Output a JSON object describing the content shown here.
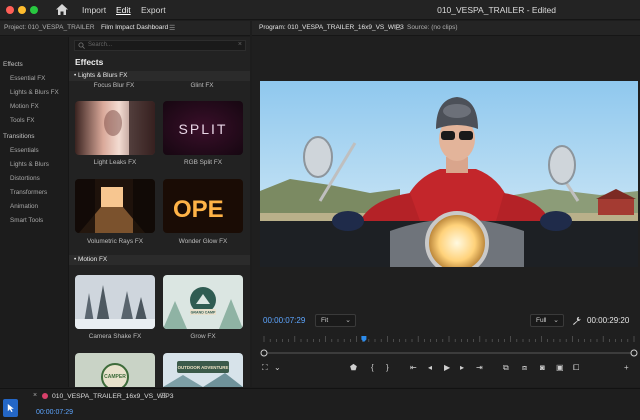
{
  "titlebar": {
    "menus": [
      "Import",
      "Edit",
      "Export"
    ],
    "active_menu": "Edit",
    "title": "010_VESPA_TRAILER - Edited",
    "colors": {
      "close": "#ff5f57",
      "minimize": "#febc2e",
      "zoom": "#28c840"
    }
  },
  "project_panel": {
    "tabs": [
      "Project: 010_VESPA_TRAILER",
      "Film Impact Dashboard"
    ],
    "menu_icon": "hamburger-icon"
  },
  "left_nav": {
    "groups": [
      {
        "title": "Effects",
        "items": [
          "Essential FX",
          "Lights & Blurs FX",
          "Motion FX",
          "Tools FX"
        ]
      },
      {
        "title": "Transitions",
        "items": [
          "Essentials",
          "Lights & Blurs",
          "Distortions",
          "Transformers",
          "Animation",
          "Smart Tools"
        ]
      }
    ]
  },
  "effects_panel": {
    "search_placeholder": "Search...",
    "title": "Effects",
    "categories": [
      {
        "name": "Lights & Blurs FX",
        "top_labels": [
          "Focus Blur FX",
          "Glint FX"
        ],
        "items": [
          "Light Leaks FX",
          "RGB Split FX",
          "Volumetric Rays FX",
          "Wonder Glow FX"
        ],
        "thumb_text": {
          "split": "SPLIT",
          "open": "OPE"
        }
      },
      {
        "name": "Motion FX",
        "items": [
          "Camera Shake FX",
          "Grow FX"
        ],
        "thumb_text": {
          "camp": "GRAND CAMP",
          "outdoor": "OUTDOOR ADVENTURE",
          "camper": "CAMPER"
        }
      }
    ]
  },
  "program_monitor": {
    "tabs": [
      "Program: 010_VESPA_TRAILER_16x9_VS_WIP3",
      "Source: (no clips)"
    ],
    "playhead_timecode": "00:00:07:29",
    "duration_timecode": "00:00:29:20",
    "fit_option": "Fit",
    "quality_option": "Full",
    "playhead_fraction": 0.27
  },
  "timeline": {
    "sequence_tab": "010_VESPA_TRAILER_16x9_VS_WIP3",
    "timecode": "00:00:07:29"
  },
  "accent_color": "#2d8ceb"
}
